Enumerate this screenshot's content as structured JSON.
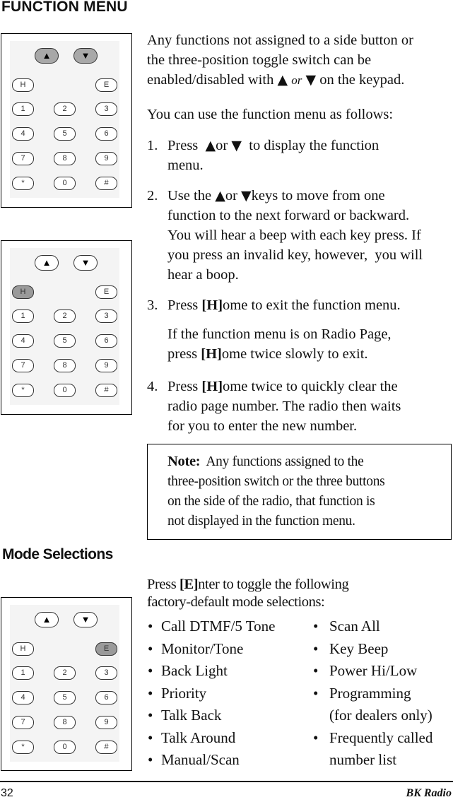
{
  "heading": "FUNCTION MENU",
  "intro": {
    "line1": "Any functions not assigned to a side button or",
    "line2": "the three-position toggle switch can be",
    "line3_pre": "enabled/disabled with",
    "line3_or": "or",
    "line3_post": "on the keypad."
  },
  "usage_intro": "You can use the function menu as follows:",
  "icons": {
    "up": "▲",
    "down": "▼"
  },
  "steps": [
    {
      "num": "1.",
      "pre": "Press",
      "or": "or",
      "post": "to display the function",
      "line2": "menu."
    },
    {
      "num": "2.",
      "pre": "Use the",
      "or": "or",
      "post": "keys to move from one",
      "line2": "function to the next forward or backward.",
      "line3": "You will hear a beep with each key press. If",
      "line4": "you press an invalid key, however,  you will",
      "line5": "hear a boop."
    },
    {
      "num": "3.",
      "pre": "Press",
      "key": "[H]",
      "post": "ome to exit the function menu.",
      "sub1": "If the function menu is on Radio Page,",
      "sub2_pre": "press",
      "sub2_key": "[H]",
      "sub2_post": "ome twice slowly to exit."
    },
    {
      "num": "4.",
      "pre": "Press",
      "key": "[H]",
      "post": "ome twice to quickly clear the",
      "line2": "radio page number. The radio then waits",
      "line3": "for you to enter the new number."
    }
  ],
  "note": {
    "label": "Note:",
    "line1": "Any functions assigned to the",
    "line2": "three-position switch or the three buttons",
    "line3": "on the side of the radio, that function is",
    "line4": "not displayed in the function menu."
  },
  "mode_heading": "Mode Selections",
  "mode_intro": {
    "pre": "Press",
    "key": "[E]",
    "post": "nter to toggle the following",
    "line2": "factory-default mode selections:"
  },
  "bullet": "•",
  "modes_left": [
    "Call DTMF/5 Tone",
    "Monitor/Tone",
    "Back Light",
    "Priority",
    "Talk Back",
    "Talk Around",
    "Manual/Scan"
  ],
  "modes_right": [
    {
      "text": "Scan All",
      "bullet": true
    },
    {
      "text": "Key Beep",
      "bullet": true
    },
    {
      "text": "Power Hi/Low",
      "bullet": true
    },
    {
      "text": "Programming",
      "bullet": true
    },
    {
      "text": "(for dealers only)",
      "bullet": false
    },
    {
      "text": "Frequently called",
      "bullet": true
    },
    {
      "text": "number list",
      "bullet": false
    }
  ],
  "keypad": {
    "keys": [
      "H",
      "E",
      "1",
      "2",
      "3",
      "4",
      "5",
      "6",
      "7",
      "8",
      "9",
      "*",
      "0",
      "#"
    ],
    "figures": [
      {
        "highlight": [
          "up",
          "down"
        ]
      },
      {
        "highlight": [
          "H"
        ]
      },
      {
        "highlight": [
          "E"
        ]
      }
    ]
  },
  "footer": {
    "page_number": "32",
    "brand": "BK Radio"
  }
}
